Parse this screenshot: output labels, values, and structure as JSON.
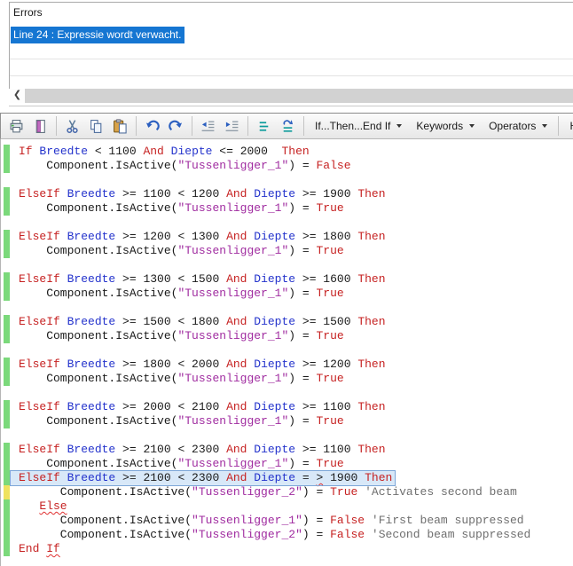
{
  "colors": {
    "keyword": "#C62222",
    "variable": "#2433CC",
    "plain": "#1A1A1A",
    "string": "#A02CA0",
    "comment": "#6F6F6F",
    "marker_green": "#7BD97B",
    "marker_yellow": "#EFE25E",
    "selection_blue": "#1576D2",
    "line_highlight_bg": "#D8E8F8",
    "line_highlight_border": "#7CA6D8",
    "squiggle": "#E03030"
  },
  "errors_panel": {
    "title": "Errors",
    "selected_error": "Line 24 : Expressie wordt verwacht.",
    "scroll_left_glyph": "❮"
  },
  "toolbar": {
    "items": [
      {
        "type": "icon",
        "name": "print-icon"
      },
      {
        "type": "icon",
        "name": "page-setup-icon"
      },
      {
        "type": "sep"
      },
      {
        "type": "icon",
        "name": "cut-icon"
      },
      {
        "type": "icon",
        "name": "copy-icon"
      },
      {
        "type": "icon",
        "name": "paste-icon"
      },
      {
        "type": "sep"
      },
      {
        "type": "icon",
        "name": "undo-icon"
      },
      {
        "type": "icon",
        "name": "redo-icon"
      },
      {
        "type": "sep"
      },
      {
        "type": "icon",
        "name": "outdent-icon"
      },
      {
        "type": "icon",
        "name": "indent-icon"
      },
      {
        "type": "sep"
      },
      {
        "type": "icon",
        "name": "comment-icon"
      },
      {
        "type": "icon",
        "name": "uncomment-icon"
      },
      {
        "type": "sep"
      },
      {
        "type": "dropdown",
        "label": "If...Then...End If"
      },
      {
        "type": "dropdown",
        "label": "Keywords"
      },
      {
        "type": "dropdown",
        "label": "Operators"
      },
      {
        "type": "sep"
      },
      {
        "type": "button",
        "label": "Header..."
      },
      {
        "type": "sep"
      },
      {
        "type": "icon",
        "name": "help-icon"
      }
    ]
  },
  "editor": {
    "lines": [
      {
        "m": "g",
        "tokens": [
          [
            "k",
            "If"
          ],
          [
            "p",
            " "
          ],
          [
            "v",
            "Breedte"
          ],
          [
            "p",
            " < 1100 "
          ],
          [
            "k",
            "And"
          ],
          [
            "p",
            " "
          ],
          [
            "v",
            "Diepte"
          ],
          [
            "p",
            " <= 2000  "
          ],
          [
            "k",
            "Then"
          ]
        ]
      },
      {
        "m": "g",
        "tokens": [
          [
            "p",
            "    Component.IsActive("
          ],
          [
            "s",
            "\"Tussenligger_1\""
          ],
          [
            "p",
            ") = "
          ],
          [
            "k",
            "False"
          ]
        ]
      },
      {
        "tokens": []
      },
      {
        "m": "g",
        "tokens": [
          [
            "k",
            "ElseIf"
          ],
          [
            "p",
            " "
          ],
          [
            "v",
            "Breedte"
          ],
          [
            "p",
            " >= 1100 < 1200 "
          ],
          [
            "k",
            "And"
          ],
          [
            "p",
            " "
          ],
          [
            "v",
            "Diepte"
          ],
          [
            "p",
            " >= 1900 "
          ],
          [
            "k",
            "Then"
          ]
        ]
      },
      {
        "m": "g",
        "tokens": [
          [
            "p",
            "    Component.IsActive("
          ],
          [
            "s",
            "\"Tussenligger_1\""
          ],
          [
            "p",
            ") = "
          ],
          [
            "k",
            "True"
          ]
        ]
      },
      {
        "tokens": []
      },
      {
        "m": "g",
        "tokens": [
          [
            "k",
            "ElseIf"
          ],
          [
            "p",
            " "
          ],
          [
            "v",
            "Breedte"
          ],
          [
            "p",
            " >= 1200 < 1300 "
          ],
          [
            "k",
            "And"
          ],
          [
            "p",
            " "
          ],
          [
            "v",
            "Diepte"
          ],
          [
            "p",
            " >= 1800 "
          ],
          [
            "k",
            "Then"
          ]
        ]
      },
      {
        "m": "g",
        "tokens": [
          [
            "p",
            "    Component.IsActive("
          ],
          [
            "s",
            "\"Tussenligger_1\""
          ],
          [
            "p",
            ") = "
          ],
          [
            "k",
            "True"
          ]
        ]
      },
      {
        "tokens": []
      },
      {
        "m": "g",
        "tokens": [
          [
            "k",
            "ElseIf"
          ],
          [
            "p",
            " "
          ],
          [
            "v",
            "Breedte"
          ],
          [
            "p",
            " >= 1300 < 1500 "
          ],
          [
            "k",
            "And"
          ],
          [
            "p",
            " "
          ],
          [
            "v",
            "Diepte"
          ],
          [
            "p",
            " >= 1600 "
          ],
          [
            "k",
            "Then"
          ]
        ]
      },
      {
        "m": "g",
        "tokens": [
          [
            "p",
            "    Component.IsActive("
          ],
          [
            "s",
            "\"Tussenligger_1\""
          ],
          [
            "p",
            ") = "
          ],
          [
            "k",
            "True"
          ]
        ]
      },
      {
        "tokens": []
      },
      {
        "m": "g",
        "tokens": [
          [
            "k",
            "ElseIf"
          ],
          [
            "p",
            " "
          ],
          [
            "v",
            "Breedte"
          ],
          [
            "p",
            " >= 1500 < 1800 "
          ],
          [
            "k",
            "And"
          ],
          [
            "p",
            " "
          ],
          [
            "v",
            "Diepte"
          ],
          [
            "p",
            " >= 1500 "
          ],
          [
            "k",
            "Then"
          ]
        ]
      },
      {
        "m": "g",
        "tokens": [
          [
            "p",
            "    Component.IsActive("
          ],
          [
            "s",
            "\"Tussenligger_1\""
          ],
          [
            "p",
            ") = "
          ],
          [
            "k",
            "True"
          ]
        ]
      },
      {
        "tokens": []
      },
      {
        "m": "g",
        "tokens": [
          [
            "k",
            "ElseIf"
          ],
          [
            "p",
            " "
          ],
          [
            "v",
            "Breedte"
          ],
          [
            "p",
            " >= 1800 < 2000 "
          ],
          [
            "k",
            "And"
          ],
          [
            "p",
            " "
          ],
          [
            "v",
            "Diepte"
          ],
          [
            "p",
            " >= 1200 "
          ],
          [
            "k",
            "Then"
          ]
        ]
      },
      {
        "m": "g",
        "tokens": [
          [
            "p",
            "    Component.IsActive("
          ],
          [
            "s",
            "\"Tussenligger_1\""
          ],
          [
            "p",
            ") = "
          ],
          [
            "k",
            "True"
          ]
        ]
      },
      {
        "tokens": []
      },
      {
        "m": "g",
        "tokens": [
          [
            "k",
            "ElseIf"
          ],
          [
            "p",
            " "
          ],
          [
            "v",
            "Breedte"
          ],
          [
            "p",
            " >= 2000 < 2100 "
          ],
          [
            "k",
            "And"
          ],
          [
            "p",
            " "
          ],
          [
            "v",
            "Diepte"
          ],
          [
            "p",
            " >= 1100 "
          ],
          [
            "k",
            "Then"
          ]
        ]
      },
      {
        "m": "g",
        "tokens": [
          [
            "p",
            "    Component.IsActive("
          ],
          [
            "s",
            "\"Tussenligger_1\""
          ],
          [
            "p",
            ") = "
          ],
          [
            "k",
            "True"
          ]
        ]
      },
      {
        "tokens": []
      },
      {
        "m": "g",
        "tokens": [
          [
            "k",
            "ElseIf"
          ],
          [
            "p",
            " "
          ],
          [
            "v",
            "Breedte"
          ],
          [
            "p",
            " >= 2100 < 2300 "
          ],
          [
            "k",
            "And"
          ],
          [
            "p",
            " "
          ],
          [
            "v",
            "Diepte"
          ],
          [
            "p",
            " >= 1100 "
          ],
          [
            "k",
            "Then"
          ]
        ]
      },
      {
        "m": "g",
        "tokens": [
          [
            "p",
            "    Component.IsActive("
          ],
          [
            "s",
            "\"Tussenligger_1\""
          ],
          [
            "p",
            ") = "
          ],
          [
            "k",
            "True"
          ]
        ]
      },
      {
        "m": "g",
        "hl": true,
        "tokens": [
          [
            "k",
            "ElseIf"
          ],
          [
            "p",
            " "
          ],
          [
            "v",
            "Breedte"
          ],
          [
            "p",
            " >= 2100 < 2300 "
          ],
          [
            "k",
            "And"
          ],
          [
            "p",
            " "
          ],
          [
            "v",
            "Diepte"
          ],
          [
            "p",
            " = "
          ],
          [
            "p",
            ">",
            1
          ],
          [
            "p",
            " 1900 "
          ],
          [
            "k",
            "Then"
          ]
        ]
      },
      {
        "m": "y",
        "tokens": [
          [
            "p",
            "      Component.IsActive("
          ],
          [
            "s",
            "\"Tussenligger_2\""
          ],
          [
            "p",
            ") = "
          ],
          [
            "k",
            "True"
          ],
          [
            "p",
            " "
          ],
          [
            "c",
            "'Activates second beam"
          ]
        ]
      },
      {
        "m": "g",
        "tokens": [
          [
            "p",
            "   "
          ],
          [
            "k",
            "Else",
            1
          ]
        ]
      },
      {
        "m": "g",
        "tokens": [
          [
            "p",
            "      Component.IsActive("
          ],
          [
            "s",
            "\"Tussenligger_1\""
          ],
          [
            "p",
            ") = "
          ],
          [
            "k",
            "False"
          ],
          [
            "p",
            " "
          ],
          [
            "c",
            "'First beam suppressed"
          ]
        ]
      },
      {
        "m": "g",
        "tokens": [
          [
            "p",
            "      Component.IsActive("
          ],
          [
            "s",
            "\"Tussenligger_2\""
          ],
          [
            "p",
            ") = "
          ],
          [
            "k",
            "False"
          ],
          [
            "p",
            " "
          ],
          [
            "c",
            "'Second beam suppressed"
          ]
        ]
      },
      {
        "m": "g",
        "tokens": [
          [
            "k",
            "End"
          ],
          [
            "p",
            " "
          ],
          [
            "k",
            "If",
            1
          ]
        ]
      }
    ]
  }
}
